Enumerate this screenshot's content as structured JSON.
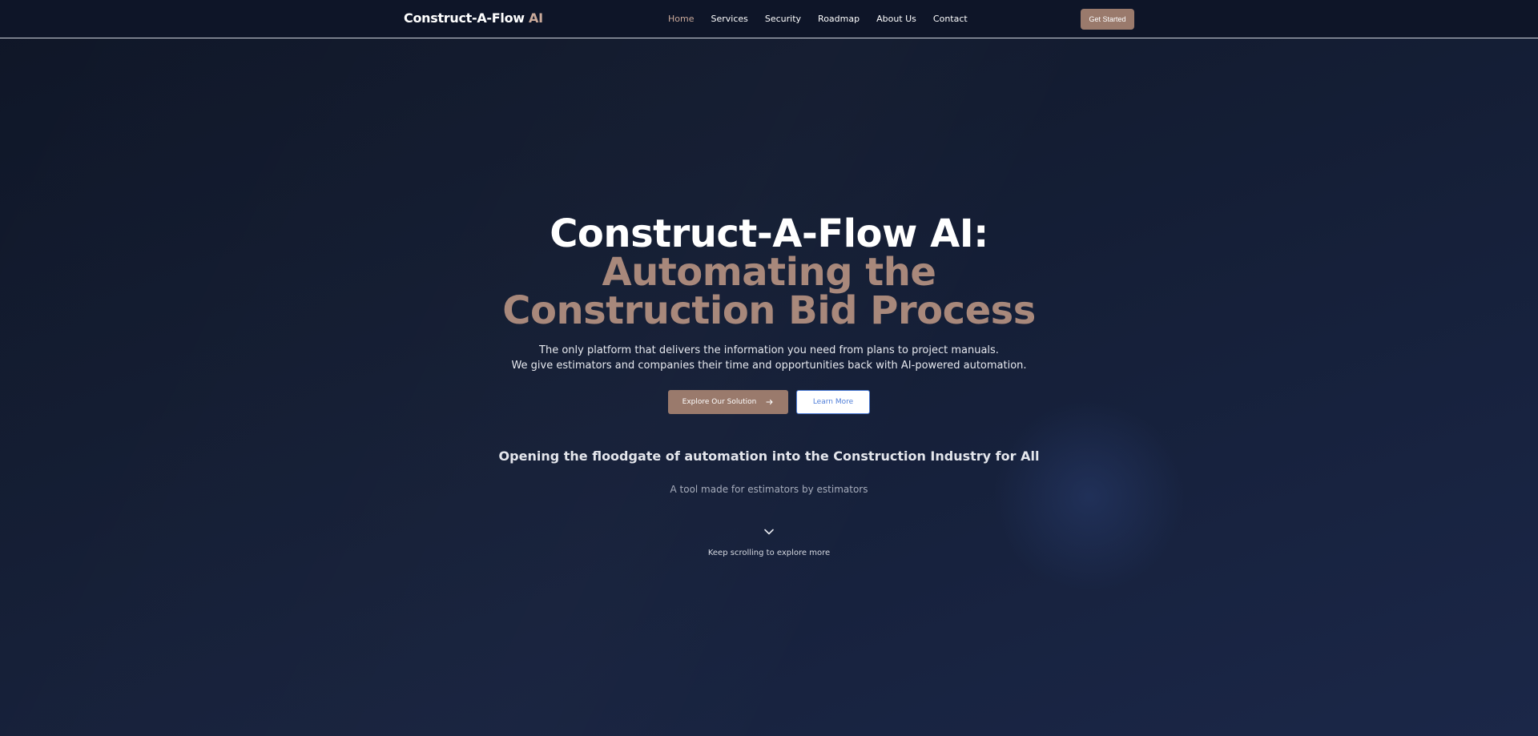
{
  "navbar": {
    "brand": "Construct-A-Flow",
    "brand_accent": "AI",
    "links": [
      {
        "label": "Home",
        "active": true
      },
      {
        "label": "Services",
        "active": false
      },
      {
        "label": "Security",
        "active": false
      },
      {
        "label": "Roadmap",
        "active": false
      },
      {
        "label": "About Us",
        "active": false
      },
      {
        "label": "Contact",
        "active": false
      }
    ],
    "cta_label": "Get Started"
  },
  "hero": {
    "title_line1": "Construct-A-Flow AI:",
    "title_line2": "Automating the Construction Bid Process",
    "subtitle_line1": "The only platform that delivers the information you need from plans to project manuals.",
    "subtitle_line2": "We give estimators and companies their time and opportunities back with AI-powered automation.",
    "primary_button": "Explore Our Solution",
    "primary_button_icon": "arrow-right-icon",
    "secondary_button": "Learn More",
    "tagline": "Opening the floodgate of automation into the Construction Industry for All",
    "sub_tagline": "A tool made for estimators by estimators",
    "scroll_icon": "chevron-down-icon",
    "scroll_label": "Keep scrolling to explore more"
  },
  "colors": {
    "accent": "#a8887b",
    "button_accent": "#9a7a6c",
    "link_blue": "#4f7ed8",
    "background": "#131c31"
  }
}
